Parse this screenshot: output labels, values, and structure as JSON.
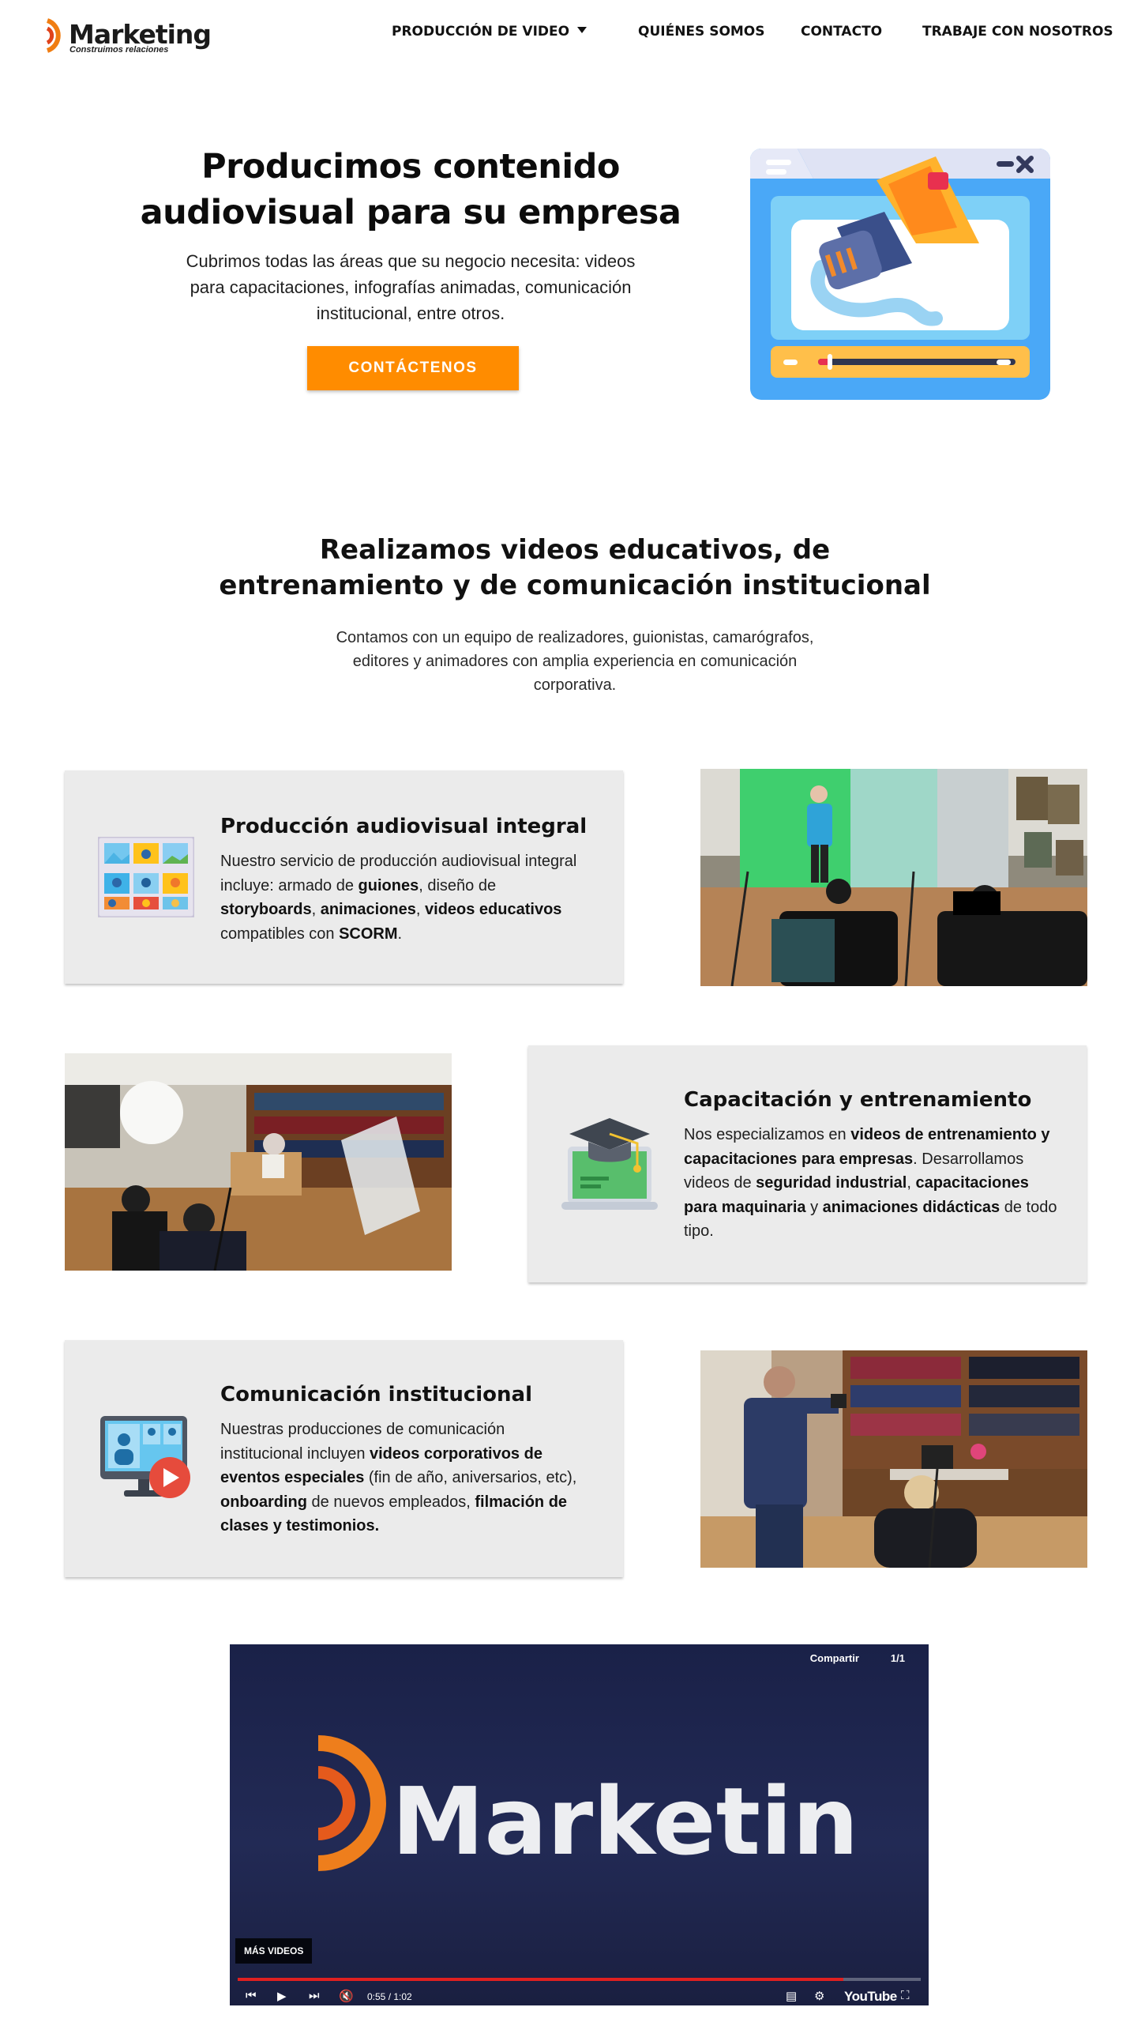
{
  "header": {
    "logo_text": "Marketing",
    "logo_slogan": "Construimos relaciones",
    "nav": [
      {
        "label": "PRODUCCIÓN DE VIDEO",
        "has_dropdown": true
      },
      {
        "label": "QUIÉNES SOMOS"
      },
      {
        "label": "CONTACTO"
      },
      {
        "label": "TRABAJE CON NOSOTROS"
      }
    ]
  },
  "hero": {
    "title": "Producimos contenido audiovisual para su empresa",
    "text": "Cubrimos todas las áreas que su negocio necesita: videos para capacitaciones, infografías animadas, comunicación institucional, entre otros.",
    "button": "CONTÁCTENOS"
  },
  "section": {
    "title": "Realizamos videos educativos, de entrenamiento y de comunicación institucional",
    "text": "Contamos con un equipo de realizadores, guionistas, camarógrafos, editores y animadores con amplia experiencia en comunicación corporativa."
  },
  "cards": [
    {
      "title": "Producción audiovisual integral",
      "parts": [
        "Nuestro servicio de producción audiovisual integral incluye: armado de ",
        "guiones",
        ", diseño de ",
        "storyboards",
        ", ",
        "animaciones",
        ", ",
        "videos educativos",
        " compatibles con ",
        "SCORM",
        "."
      ]
    },
    {
      "title": "Capacitación y entrenamiento",
      "parts": [
        "Nos especializamos en ",
        "videos de entrenamiento y capacitaciones para empresas",
        ". Desarrollamos videos de ",
        "seguridad industrial",
        ", ",
        "capacitaciones para maquinaria",
        " y ",
        "animaciones didácticas",
        " de todo tipo."
      ]
    },
    {
      "title": "Comunicación institucional",
      "parts": [
        "Nuestras producciones de comunicación institucional incluyen ",
        "videos corporativos de eventos especiales",
        " (fin de año, aniversarios, etc), ",
        "onboarding",
        " de nuevos empleados, ",
        "filmación de clases y testimonios."
      ]
    }
  ],
  "video": {
    "share": "Compartir",
    "counter": "1/1",
    "more_videos": "MÁS VIDEOS",
    "time": "0:55 / 1:02",
    "progress": 0.887,
    "brand_text": "Marketin",
    "youtube": "YouTube"
  },
  "colors": {
    "accent": "#ff8c00",
    "card_bg": "#ebebeb",
    "video_bg": "#1f2650"
  }
}
